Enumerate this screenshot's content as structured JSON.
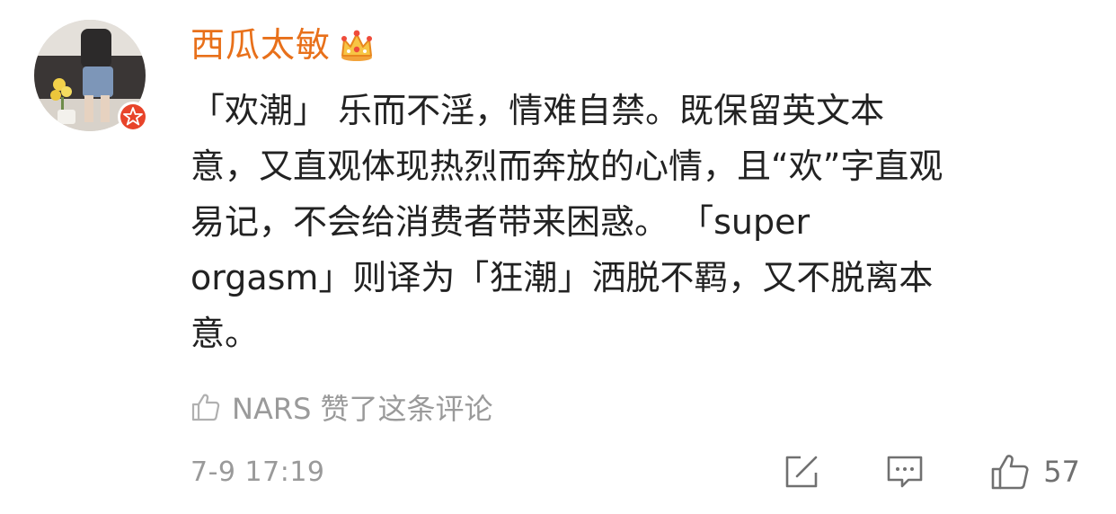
{
  "user": {
    "name": "西瓜太敏",
    "avatar_icon": "avatar-photo",
    "badge_icon": "verified-star-icon",
    "crown_icon": "crown-icon"
  },
  "comment": {
    "lines": [
      "「欢潮」 乐而不淫，情难自禁。既保留英文本",
      "意，又直观体现热烈而奔放的心情，且“欢”字直观",
      "易记，不会给消费者带来困惑。 「super",
      "orgasm」则译为「狂潮」洒脱不羁，又不脱离本",
      "意。"
    ]
  },
  "liked_by": {
    "text": "NARS 赞了这条评论",
    "icon": "thumbs-up-outline-icon"
  },
  "footer": {
    "timestamp": "7-9 17:19",
    "share_icon": "edit-share-icon",
    "reply_icon": "comment-bubble-icon",
    "like_icon": "thumbs-up-icon",
    "like_count": "57"
  },
  "colors": {
    "username": "#e8701a",
    "text": "#222222",
    "muted": "#9a9a9a",
    "badge": "#e8442a"
  }
}
